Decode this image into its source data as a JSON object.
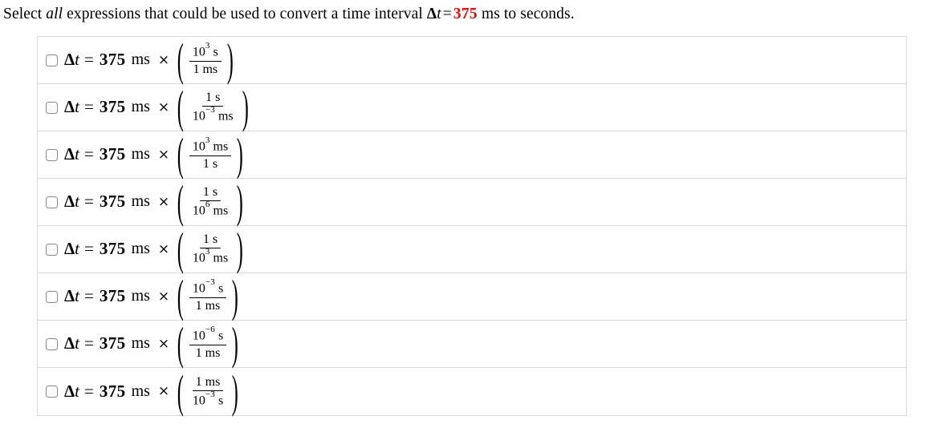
{
  "prompt": {
    "lead": "Select ",
    "emphasis": "all",
    "mid": " expressions that could be used to convert a time interval ",
    "var_delta": "Δ",
    "var_t": "t",
    "equals": "=",
    "value": "375",
    "unit": "ms",
    "tail": " to seconds."
  },
  "expression_common": {
    "delta": "Δ",
    "var": "t",
    "equals": "=",
    "value": "375",
    "unit": "ms",
    "times": "×",
    "paren_open": "(",
    "paren_close": ")"
  },
  "colors": {
    "highlight": "#ff0000",
    "text": "#000000",
    "border": "#d8d8d8",
    "checkbox_border": "#8a8a8a",
    "background": "#ffffff"
  },
  "options": [
    {
      "id": "option-1",
      "checked": false,
      "numerator": {
        "base": "10",
        "exponent": "3",
        "unit": "s"
      },
      "denominator": {
        "base": "1",
        "exponent": "",
        "unit": "ms"
      },
      "num_text": "10³ s",
      "den_text": "1 ms"
    },
    {
      "id": "option-2",
      "checked": false,
      "numerator": {
        "base": "1",
        "exponent": "",
        "unit": "s"
      },
      "denominator": {
        "base": "10",
        "exponent": "−3",
        "unit": "ms"
      },
      "num_text": "1 s",
      "den_text": "10⁻³ ms"
    },
    {
      "id": "option-3",
      "checked": false,
      "numerator": {
        "base": "10",
        "exponent": "3",
        "unit": "ms"
      },
      "denominator": {
        "base": "1",
        "exponent": "",
        "unit": "s"
      },
      "num_text": "10³ ms",
      "den_text": "1 s"
    },
    {
      "id": "option-4",
      "checked": false,
      "numerator": {
        "base": "1",
        "exponent": "",
        "unit": "s"
      },
      "denominator": {
        "base": "10",
        "exponent": "6",
        "unit": "ms"
      },
      "num_text": "1 s",
      "den_text": "10⁶ ms"
    },
    {
      "id": "option-5",
      "checked": false,
      "numerator": {
        "base": "1",
        "exponent": "",
        "unit": "s"
      },
      "denominator": {
        "base": "10",
        "exponent": "3",
        "unit": "ms"
      },
      "num_text": "1 s",
      "den_text": "10³ ms"
    },
    {
      "id": "option-6",
      "checked": false,
      "numerator": {
        "base": "10",
        "exponent": "−3",
        "unit": "s"
      },
      "denominator": {
        "base": "1",
        "exponent": "",
        "unit": "ms"
      },
      "num_text": "10⁻³ s",
      "den_text": "1 ms"
    },
    {
      "id": "option-7",
      "checked": false,
      "numerator": {
        "base": "10",
        "exponent": "−6",
        "unit": "s"
      },
      "denominator": {
        "base": "1",
        "exponent": "",
        "unit": "ms"
      },
      "num_text": "10⁻⁶ s",
      "den_text": "1 ms"
    },
    {
      "id": "option-8",
      "checked": false,
      "numerator": {
        "base": "1",
        "exponent": "",
        "unit": "ms"
      },
      "denominator": {
        "base": "10",
        "exponent": "−3",
        "unit": "s"
      },
      "num_text": "1 ms",
      "den_text": "10⁻³ s"
    }
  ]
}
